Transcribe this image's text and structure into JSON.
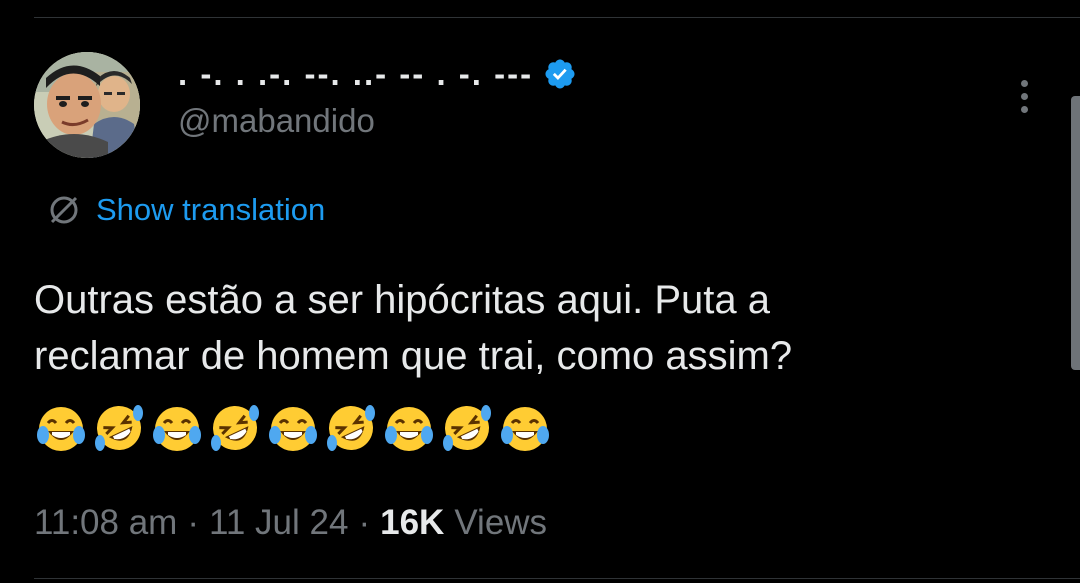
{
  "colors": {
    "background": "#000000",
    "text_primary": "#e7e9ea",
    "text_secondary": "#71767b",
    "accent": "#1d9bf0",
    "divider": "#2f3336"
  },
  "author": {
    "display_name": ". -. . .-. --. ..- -- . -. ---",
    "handle": "@mabandido",
    "verified": true,
    "avatar_icon": "avatar-cartoon-characters"
  },
  "translation": {
    "label": "Show translation",
    "icon": "globe-icon"
  },
  "tweet": {
    "text": "Outras estão a ser hipócritas aqui. Puta a\nreclamar de homem que trai, como assim?",
    "emojis": [
      "😂",
      "🤣",
      "😂",
      "🤣",
      "😂",
      "🤣",
      "😂",
      "🤣",
      "😂"
    ]
  },
  "meta": {
    "time": "11:08 am",
    "separator": "·",
    "date": "11 Jul 24",
    "views_count": "16K",
    "views_label": "Views"
  },
  "icons": {
    "more": "more-vertical-icon",
    "verified": "verified-badge-icon"
  }
}
